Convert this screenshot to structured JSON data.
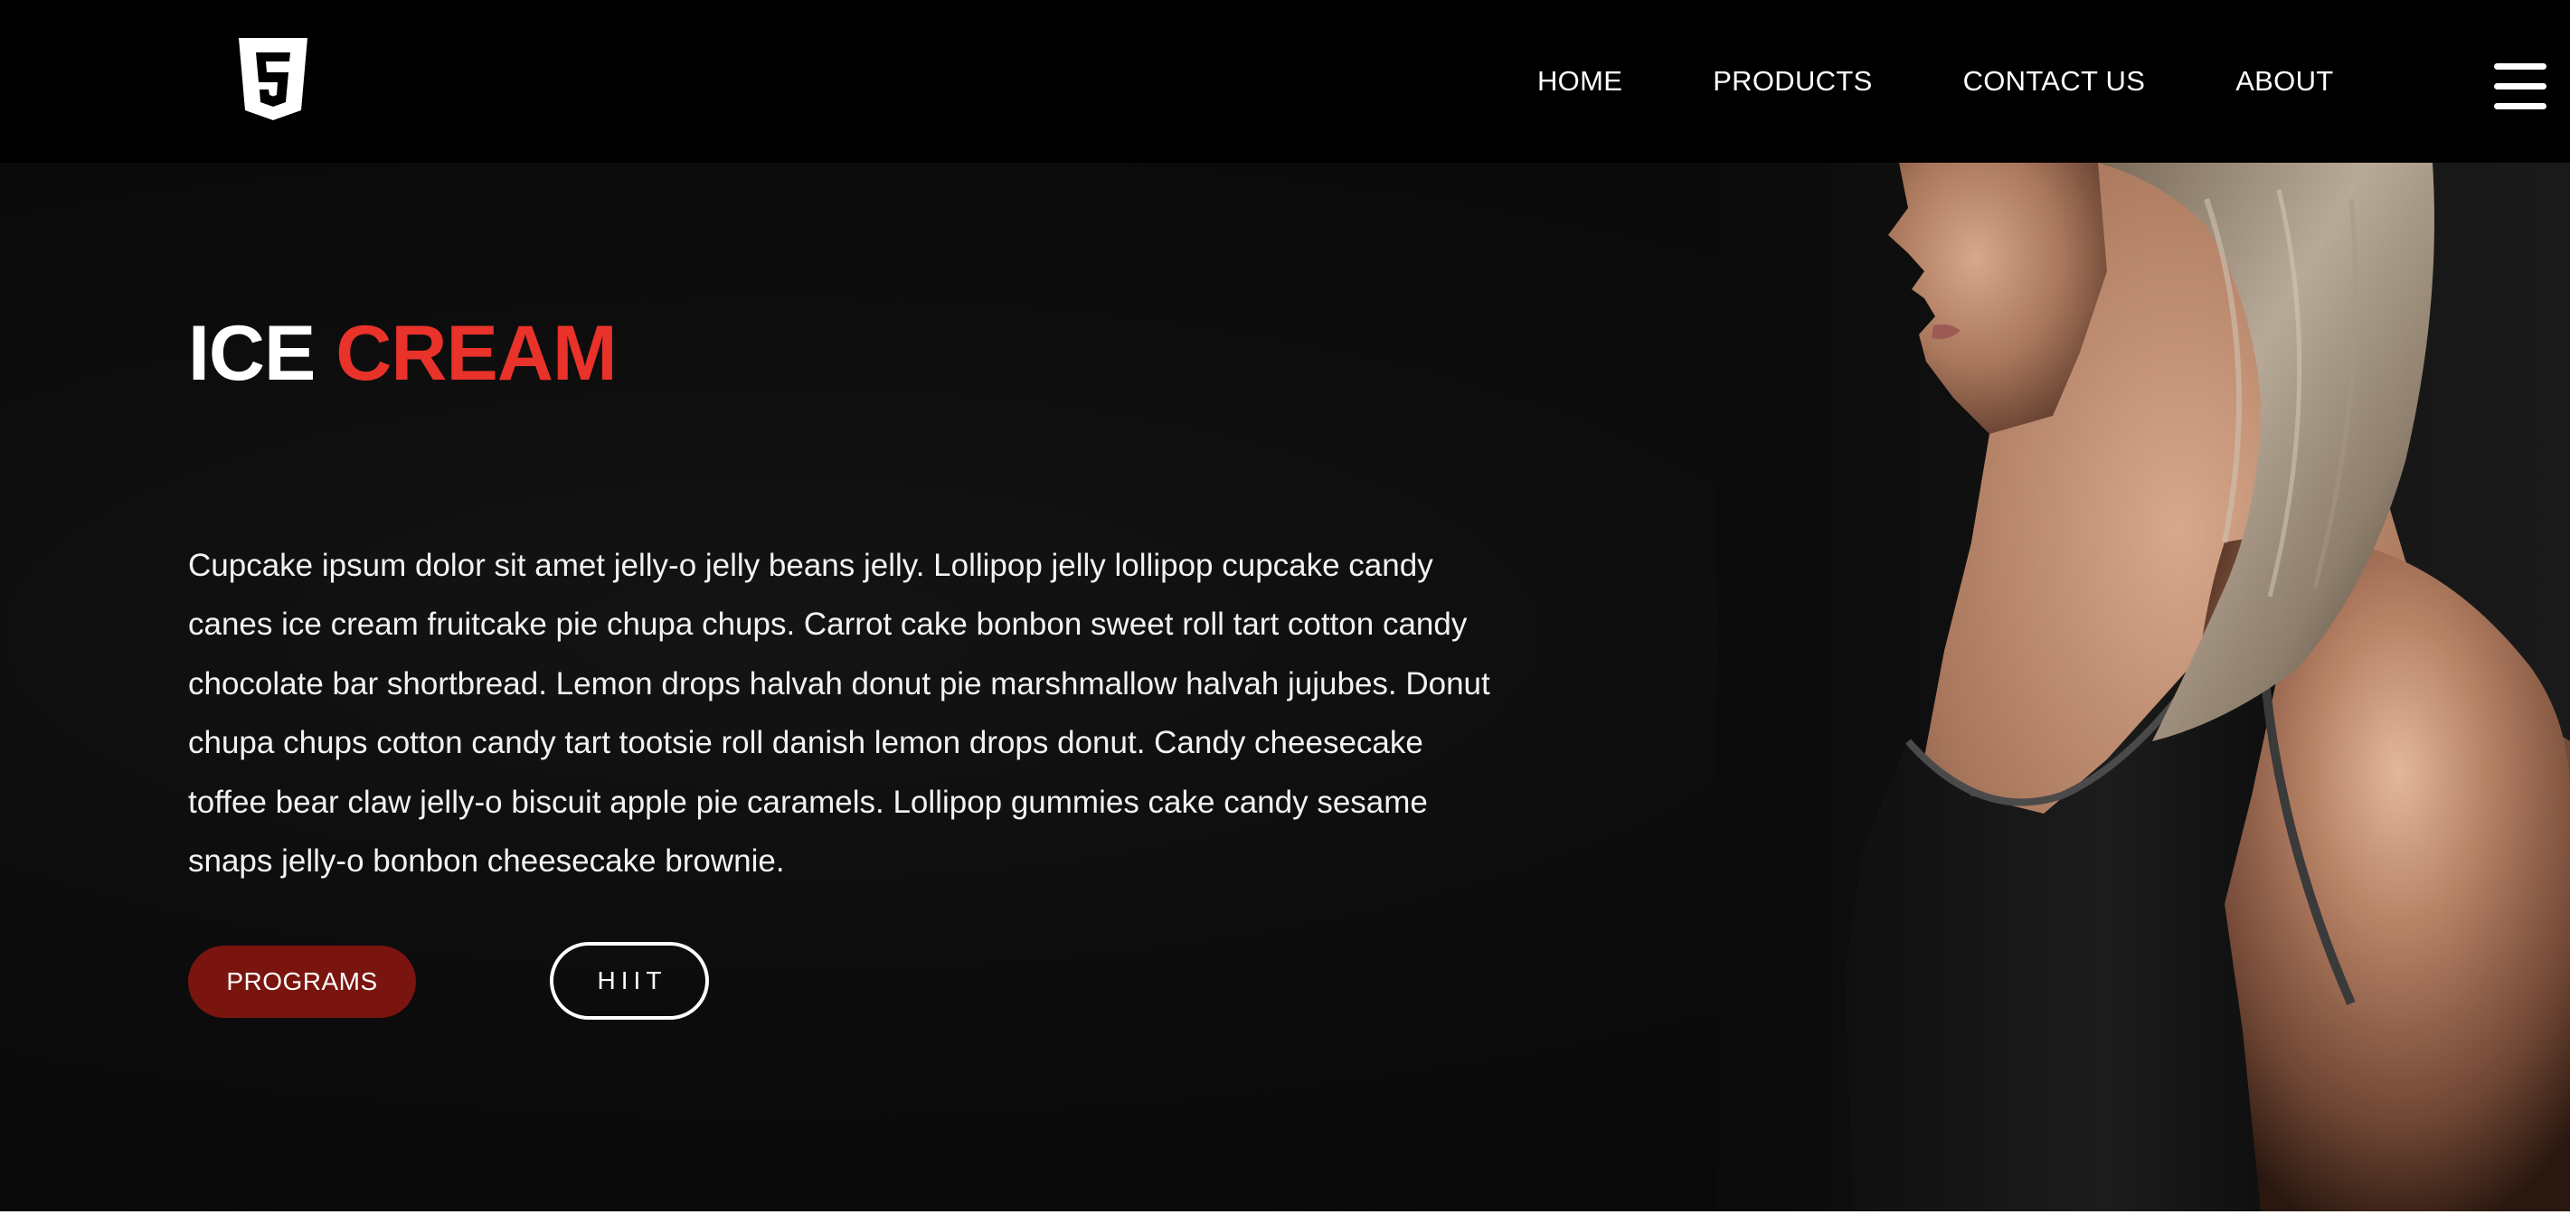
{
  "nav": {
    "logo_icon": "html5-shield-icon",
    "links": [
      "HOME",
      "PRODUCTS",
      "CONTACT US",
      "ABOUT"
    ],
    "menu_icon": "hamburger-menu-icon"
  },
  "hero": {
    "title_part1": "ICE",
    "title_part2": "CREAM",
    "body": "Cupcake ipsum dolor sit amet jelly-o jelly beans jelly. Lollipop jelly lollipop cupcake candy canes ice cream fruitcake pie chupa chups. Carrot cake bonbon sweet roll tart cotton candy chocolate bar shortbread. Lemon drops halvah donut pie marshmallow halvah jujubes. Donut chupa chups cotton candy tart tootsie roll danish lemon drops donut. Candy cheesecake toffee bear claw jelly-o biscuit apple pie caramels. Lollipop gummies cake candy sesame snaps jelly-o bonbon cheesecake brownie.",
    "primary_button": "PROGRAMS",
    "secondary_button": "HIIT",
    "photo_icon": "athlete-profile-photo"
  },
  "colors": {
    "nav_bg": "#000000",
    "hero_bg": "#0b0b0b",
    "accent_red": "#e8322a",
    "button_red": "#7a140f",
    "text": "#ffffff"
  }
}
